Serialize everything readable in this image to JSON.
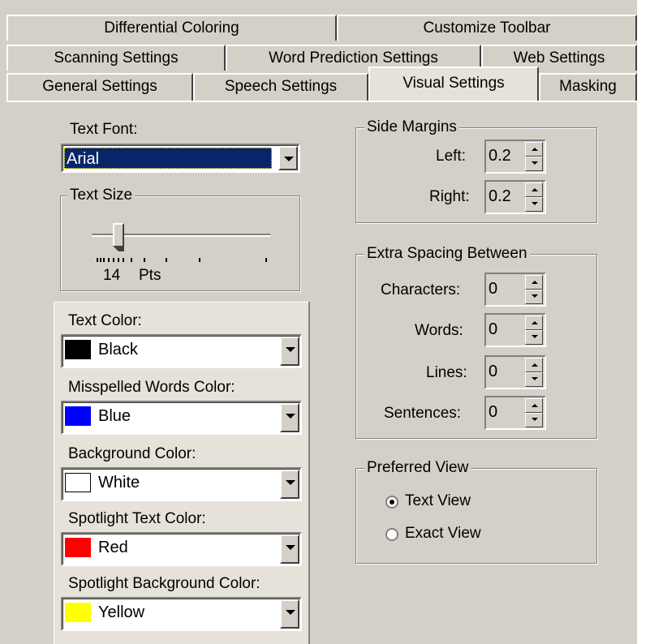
{
  "tabs": {
    "row1": [
      "Differential Coloring",
      "Customize Toolbar"
    ],
    "row2": [
      "Scanning Settings",
      "Word Prediction Settings",
      "Web Settings"
    ],
    "row3": [
      "General Settings",
      "Speech Settings",
      "Visual Settings",
      "Masking"
    ],
    "active": "Visual Settings"
  },
  "text_font": {
    "label": "Text Font:",
    "value": "Arial"
  },
  "text_size": {
    "group_title": "Text Size",
    "value_pts": 14,
    "value_label": "14",
    "unit_label": "Pts"
  },
  "colors": [
    {
      "label": "Text Color:",
      "value": "Black",
      "swatch": "#000000"
    },
    {
      "label": "Misspelled Words Color:",
      "value": "Blue",
      "swatch": "#0000ff"
    },
    {
      "label": "Background Color:",
      "value": "White",
      "swatch": "#ffffff"
    },
    {
      "label": "Spotlight Text Color:",
      "value": "Red",
      "swatch": "#ff0000"
    },
    {
      "label": "Spotlight Background Color:",
      "value": "Yellow",
      "swatch": "#ffff00"
    }
  ],
  "side_margins": {
    "title": "Side Margins",
    "left_label": "Left:",
    "left_value": "0.2",
    "right_label": "Right:",
    "right_value": "0.2"
  },
  "extra_spacing": {
    "title": "Extra Spacing Between",
    "characters_label": "Characters:",
    "characters_value": "0",
    "words_label": "Words:",
    "words_value": "0",
    "lines_label": "Lines:",
    "lines_value": "0",
    "sentences_label": "Sentences:",
    "sentences_value": "0"
  },
  "preferred_view": {
    "title": "Preferred View",
    "option1": "Text View",
    "option2": "Exact View",
    "selected": "Text View"
  },
  "theme": {
    "panel": "#d4d0c8",
    "selection": "#0a246a"
  }
}
